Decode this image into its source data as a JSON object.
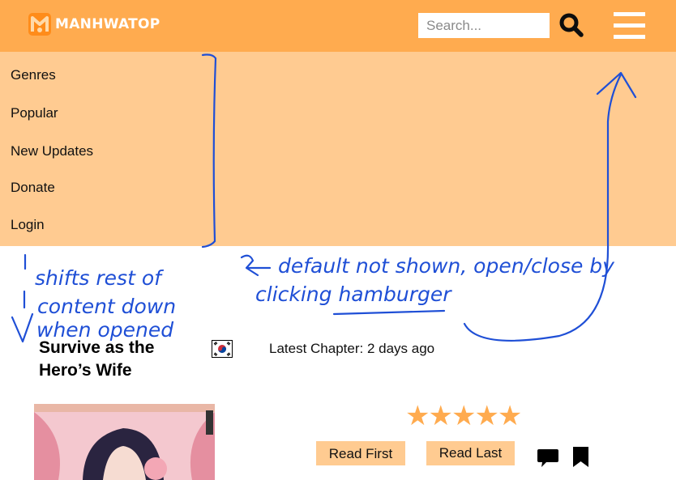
{
  "header": {
    "logo_text": "MANHWATOP",
    "search_placeholder": "Search...",
    "search_icon": "search-icon",
    "menu_icon": "hamburger-icon",
    "brand_color": "#ffab4f"
  },
  "menu": {
    "items": [
      {
        "label": "Genres"
      },
      {
        "label": "Popular"
      },
      {
        "label": "New Updates"
      },
      {
        "label": "Donate"
      },
      {
        "label": "Login"
      }
    ],
    "background": "#ffcb91"
  },
  "annotations": {
    "left_note_lines": [
      "shifts rest of",
      "content down",
      "when opened"
    ],
    "right_note_lines": [
      "default not shown, open/close by",
      "clicking hamburger"
    ],
    "ink_color": "#1f4fd6"
  },
  "manga": {
    "title": "Survive as the Hero’s Wife",
    "flag": "south-korea-flag",
    "latest_chapter": "Latest Chapter: 2 days ago",
    "rating_stars": 5,
    "stars_text": "★★★★★",
    "read_first_label": "Read First",
    "read_last_label": "Read Last",
    "comment_icon": "comment-icon",
    "bookmark_icon": "bookmark-icon"
  }
}
